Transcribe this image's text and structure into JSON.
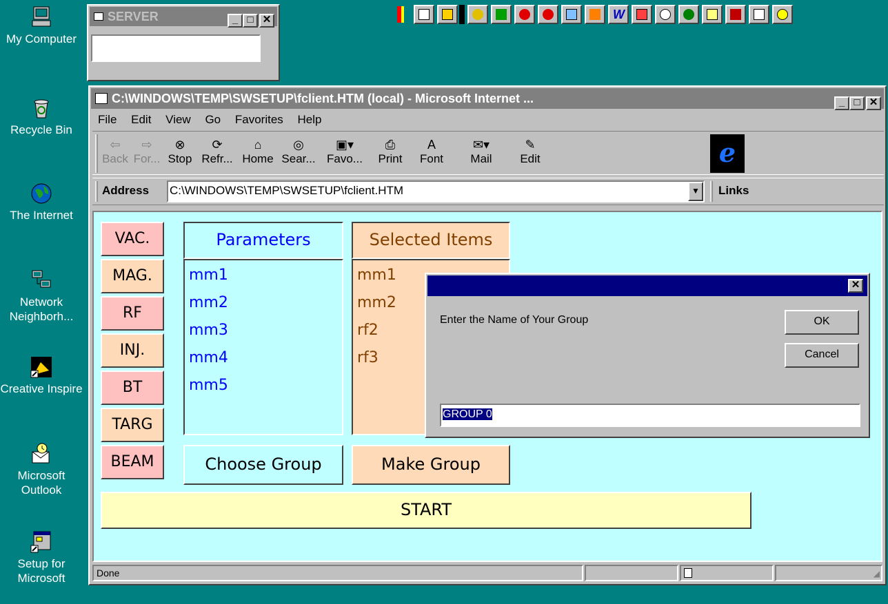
{
  "desktop": {
    "icons": [
      {
        "label": "My Computer"
      },
      {
        "label": "Recycle Bin"
      },
      {
        "label": "The Internet"
      },
      {
        "label": "Network Neighborh..."
      },
      {
        "label": "Creative Inspire"
      },
      {
        "label": "Microsoft Outlook"
      },
      {
        "label": "Setup for Microsoft"
      }
    ]
  },
  "server_window": {
    "title": "SERVER",
    "minimize": "_",
    "maximize": "□",
    "close": "✕"
  },
  "browser": {
    "title": "C:\\WINDOWS\\TEMP\\SWSETUP\\fclient.HTM (local) - Microsoft Internet ...",
    "menu": [
      "File",
      "Edit",
      "View",
      "Go",
      "Favorites",
      "Help"
    ],
    "toolbar": {
      "back": "Back",
      "forward": "For...",
      "stop": "Stop",
      "refresh": "Refr...",
      "home": "Home",
      "search": "Sear...",
      "favorites": "Favo...",
      "print": "Print",
      "font": "Font",
      "mail": "Mail",
      "edit": "Edit"
    },
    "address_label": "Address",
    "address_value": "C:\\WINDOWS\\TEMP\\SWSETUP\\fclient.HTM",
    "links_label": "Links",
    "status_text": "Done"
  },
  "page": {
    "nav_buttons": [
      "VAC.",
      "MAG.",
      "RF",
      "INJ.",
      "BT",
      "TARG",
      "BEAM"
    ],
    "parameters_heading": "Parameters",
    "parameters": [
      "mm1",
      "mm2",
      "mm3",
      "mm4",
      "mm5"
    ],
    "selected_heading": "Selected Items",
    "selected": [
      "mm1",
      "mm2",
      "rf2",
      "rf3"
    ],
    "choose_group": "Choose Group",
    "make_group": "Make Group",
    "start": "START"
  },
  "dialog": {
    "prompt": "Enter the Name of Your Group",
    "ok": "OK",
    "cancel": "Cancel",
    "input_value": "GROUP 0",
    "close": "✕"
  },
  "colors": {
    "desktop": "#008080",
    "title_active": "#000080",
    "title_inactive": "#808080",
    "page_bg": "#c0ffff",
    "parameter_text": "#0000ff",
    "selected_text": "#804000",
    "start_bg": "#ffffc0"
  }
}
